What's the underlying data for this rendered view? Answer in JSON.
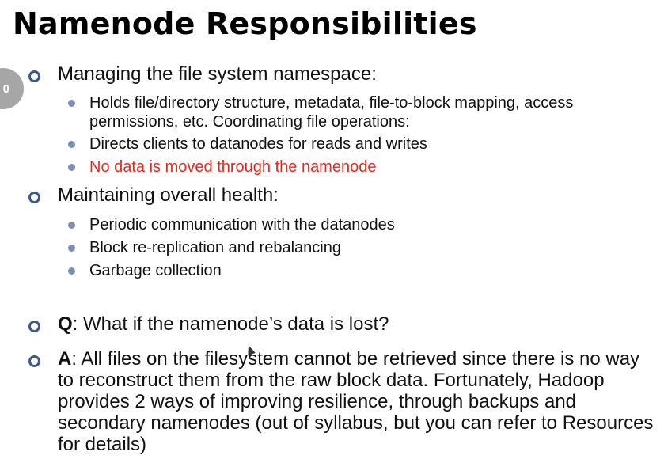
{
  "slide": {
    "title": "Namenode Responsibilities",
    "slide_number_fragment": "0"
  },
  "bullets": [
    {
      "text": "Managing the file system namespace:",
      "sub": [
        {
          "text": "Holds file/directory structure, metadata, file-to-block mapping, access permissions, etc. Coordinating file operations:",
          "color": "#111111"
        },
        {
          "text": "Directs clients to datanodes for reads and writes",
          "color": "#111111"
        },
        {
          "text": "No data is moved through the namenode",
          "color": "#e8261b"
        }
      ]
    },
    {
      "text": "Maintaining overall health:",
      "sub": [
        {
          "text": "Periodic communication with the datanodes"
        },
        {
          "text": "Block re-replication and rebalancing"
        },
        {
          "text": "Garbage collection"
        }
      ]
    },
    {
      "label": "Q",
      "text": ": What if the namenode’s data is lost?"
    },
    {
      "label": "A",
      "text": ": All files on the filesystem cannot be retrieved since there is no way to reconstruct them from the raw block data. Fortunately, Hadoop provides 2 ways of improving resilience, through backups and secondary namenodes (out of syllabus, but you can refer to Resources for details)"
    }
  ],
  "colors": {
    "ring_bullet": "#3d5a8a",
    "dot_bullet": "#7c8fb5",
    "highlight_red": "#e8261b",
    "badge_grey": "#a6a6a6"
  }
}
